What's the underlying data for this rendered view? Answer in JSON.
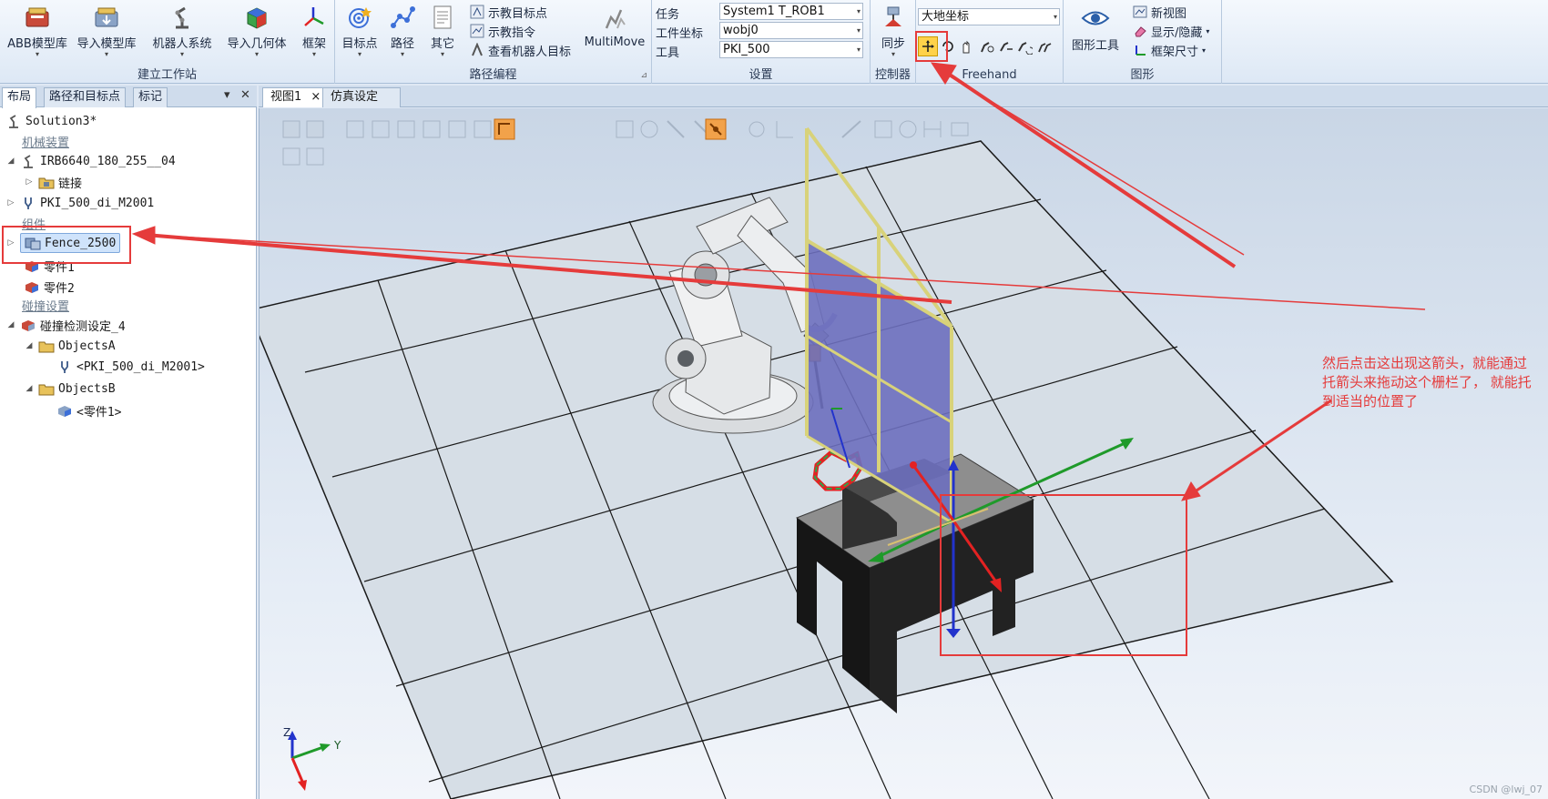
{
  "ribbon": {
    "groups": {
      "build": {
        "label": "建立工作站",
        "abb_library": "ABB模型库",
        "import_library": "导入模型库",
        "robot_system": "机器人系统",
        "import_geometry": "导入几何体",
        "frame": "框架"
      },
      "path": {
        "label": "路径编程",
        "target": "目标点",
        "path": "路径",
        "other": "其它",
        "teach_target": "示教目标点",
        "teach_instruction": "示教指令",
        "view_robot_target": "查看机器人目标",
        "multimove": "MultiMove"
      },
      "settings": {
        "label": "设置",
        "task_label": "任务",
        "task_value": "System1 T_ROB1",
        "wobj_label": "工件坐标",
        "wobj_value": "wobj0",
        "tool_label": "工具",
        "tool_value": "PKI_500"
      },
      "controller": {
        "label": "控制器",
        "sync": "同步"
      },
      "freehand": {
        "label": "Freehand",
        "frame_value": "大地坐标",
        "icons": [
          "move-icon",
          "rotate-icon",
          "drag-icon",
          "jog-joint-icon",
          "jog-linear-icon",
          "jog-reorient-icon",
          "multi-robot-jog-icon"
        ]
      },
      "graphics": {
        "label": "图形",
        "graphics_tools": "图形工具",
        "new_view": "新视图",
        "show_hide": "显示/隐藏",
        "frame_size": "框架尺寸"
      }
    }
  },
  "left_pane": {
    "tabs": [
      "布局",
      "路径和目标点",
      "标记"
    ],
    "pin": "▾",
    "close": "✕",
    "tree": {
      "root": "Solution3*",
      "cat_mechanism": "机械装置",
      "robot": "IRB6640_180_255__04",
      "links": "链接",
      "tool": "PKI_500_di_M2001",
      "cat_component": "组件",
      "fence": "Fence_2500",
      "part1": "零件1",
      "part2": "零件2",
      "cat_collision": "碰撞设置",
      "collision_set": "碰撞检测设定_4",
      "objects_a": "ObjectsA",
      "objects_a_item": "<PKI_500_di_M2001>",
      "objects_b": "ObjectsB",
      "objects_b_item": "<零件1>"
    }
  },
  "view": {
    "tabs": [
      "视图1",
      "仿真设定"
    ],
    "tab_close": "×",
    "axis_z": "Z",
    "axis_y": "Y",
    "annotation": "然后点击这出现这箭头，就能通过托箭头来拖动这个栅栏了，  就能托到适当的位置了",
    "watermark": "CSDN @lwj_07"
  },
  "colors": {
    "annotation_red": "#e53b3b",
    "fence_yellow": "#d8d27a",
    "fence_panel": "#6d6fbe",
    "axis_red": "#e32222",
    "axis_green": "#1f9a2a",
    "axis_blue": "#2233cc"
  }
}
